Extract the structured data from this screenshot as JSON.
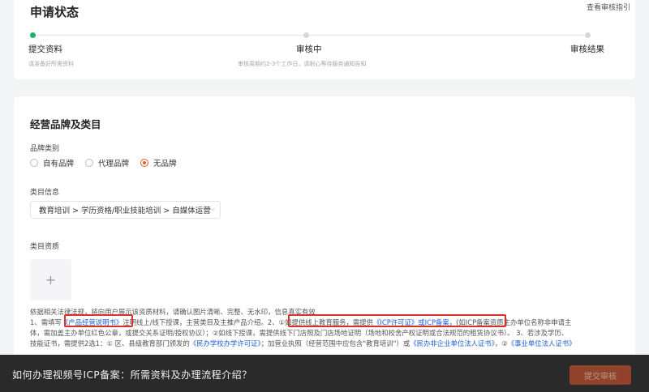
{
  "status_card": {
    "title": "申请状态",
    "guide_link": "查看审核指引",
    "steps": [
      {
        "label": "提交资料",
        "sub": "请准备好所需资料"
      },
      {
        "label": "审核中",
        "sub": "审核周期约2-3个工作日，请耐心等待服务通知告知"
      },
      {
        "label": "审核结果",
        "sub": ""
      }
    ]
  },
  "brand_card": {
    "title": "经营品牌及类目",
    "brand_type_label": "品牌类别",
    "brand_options": [
      "自有品牌",
      "代理品牌",
      "无品牌"
    ],
    "selected_brand": "无品牌",
    "category_label": "类目信息",
    "category_value": "教育培训 > 学历资格/职业技能培训 > 自媒体运营",
    "qualification_label": "类目资质",
    "upload_glyph": "+",
    "desc_line1": "依据相关法律法规，将向用户展示该资质材料，请确认图片清晰、完整、无水印，信息真实有效",
    "desc_line2a": "1、需填写",
    "desc_line2b": "《产品经营说明书》",
    "desc_line2c": "注明线上/线下授课，主营类目及主推产品介绍。",
    "desc_line2d": "2、①如提供线上教育服务，需提供",
    "desc_line2e": "《ICP许可证》",
    "desc_line2f": "或ICP备案，",
    "desc_line2g": "(如ICP备案资质主办单位名称非申请主",
    "desc_line3": "体，需加盖主办单位红色公章，或提交关系证明/授权协议）；②如线下授课，需提供线下门店照及门店场地证明（场地和校舍产权证明或合法规范的租赁协议书）。 3、若涉及学历、",
    "desc_line4a": "技能证书，需提供2选1：① 区、县级教育部门颁发的",
    "desc_line4b": "《民办学校办学许可证》",
    "desc_line4c": "；加营业执照（经营范围中应包含\"教育培训\"）或",
    "desc_line4d": "《民办非企业单位法人证书》",
    "desc_line4e": "，②",
    "desc_line4f": "《事业单位法人证书》"
  },
  "bottom_bar": {
    "caption": "如何办理视频号ICP备案：所需资料及办理流程介绍？",
    "submit_label": "提交审核"
  },
  "colors": {
    "accent_green": "#19b36b",
    "radio_orange": "#f05a28",
    "highlight_red": "#d9302a",
    "link_blue": "#1f5fd6"
  }
}
